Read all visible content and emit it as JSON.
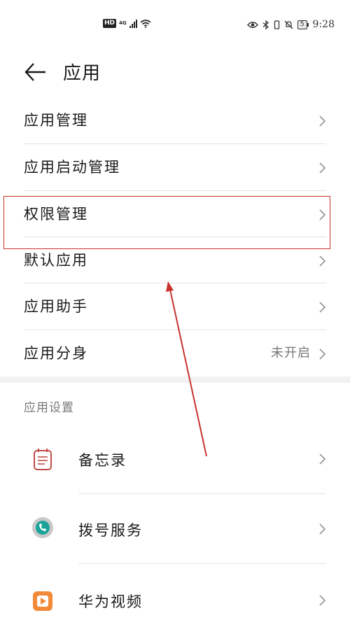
{
  "status_bar": {
    "hd": "HD",
    "network": "4G",
    "battery": "5",
    "time": "9:28"
  },
  "header": {
    "title": "应用"
  },
  "menu_items": [
    {
      "label": "应用管理",
      "value": ""
    },
    {
      "label": "应用启动管理",
      "value": ""
    },
    {
      "label": "权限管理",
      "value": ""
    },
    {
      "label": "默认应用",
      "value": ""
    },
    {
      "label": "应用助手",
      "value": ""
    },
    {
      "label": "应用分身",
      "value": "未开启"
    }
  ],
  "section": {
    "title": "应用设置"
  },
  "apps": [
    {
      "label": "备忘录",
      "icon": "memo-icon"
    },
    {
      "label": "拨号服务",
      "icon": "dialer-icon"
    },
    {
      "label": "华为视频",
      "icon": "video-icon"
    }
  ],
  "colors": {
    "highlight": "#c8332e",
    "chevron": "#9a9a9a"
  }
}
